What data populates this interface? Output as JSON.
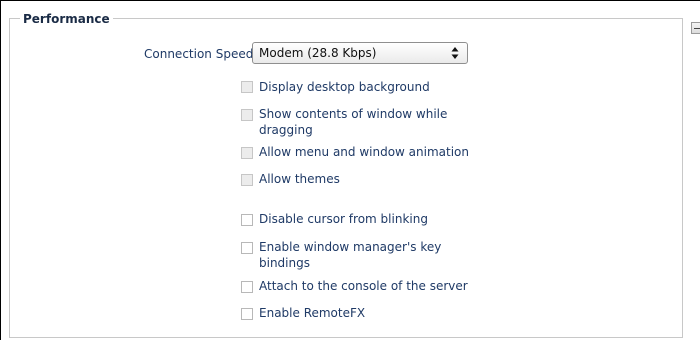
{
  "section": {
    "title": "Performance"
  },
  "connection": {
    "label": "Connection Speed",
    "selected": "Modem (28.8 Kbps)"
  },
  "options": [
    {
      "label": "Display desktop background",
      "checked": false,
      "enabled": false
    },
    {
      "label": "Show contents of window while dragging",
      "checked": false,
      "enabled": false
    },
    {
      "label": "Allow menu and window animation",
      "checked": false,
      "enabled": false
    },
    {
      "label": "Allow themes",
      "checked": false,
      "enabled": false
    },
    {
      "label": "Disable cursor from blinking",
      "checked": false,
      "enabled": true
    },
    {
      "label": "Enable window manager's key bindings",
      "checked": false,
      "enabled": true
    },
    {
      "label": "Attach to the console of the server",
      "checked": false,
      "enabled": true
    },
    {
      "label": "Enable RemoteFX",
      "checked": false,
      "enabled": true
    }
  ],
  "icons": {
    "collapse": "minus-icon",
    "select_arrows": "updown-arrows-icon"
  }
}
